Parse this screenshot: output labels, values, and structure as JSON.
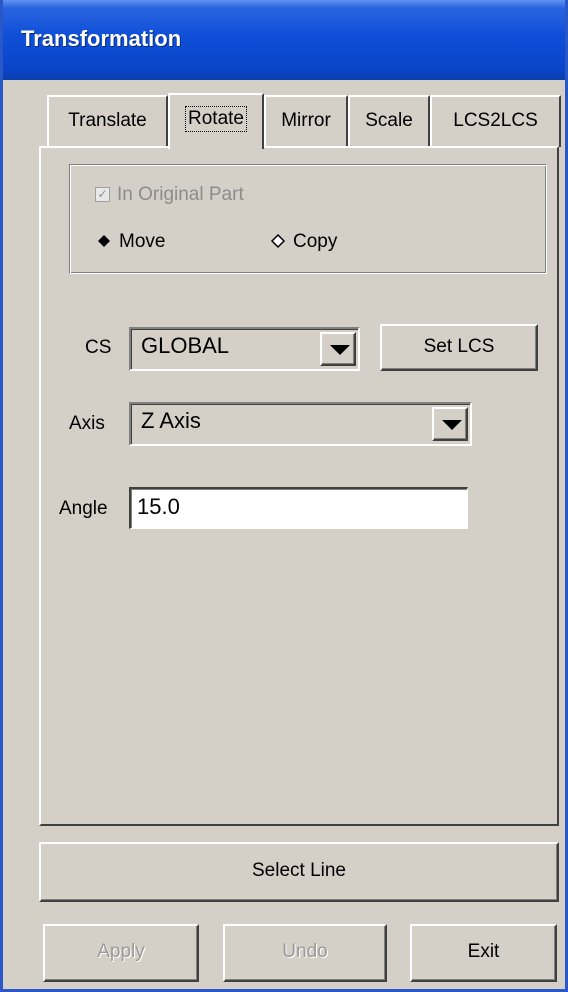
{
  "window": {
    "title": "Transformation"
  },
  "tabs": [
    {
      "label": "Translate",
      "active": false
    },
    {
      "label": "Rotate",
      "active": true
    },
    {
      "label": "Mirror",
      "active": false
    },
    {
      "label": "Scale",
      "active": false
    },
    {
      "label": "LCS2LCS",
      "active": false
    }
  ],
  "options": {
    "in_original_part_label": "In Original Part",
    "in_original_part_checked": true,
    "in_original_part_enabled": false,
    "move_label": "Move",
    "copy_label": "Copy",
    "selected_mode": "Move"
  },
  "cs": {
    "label": "CS",
    "value": "GLOBAL",
    "set_lcs_label": "Set LCS"
  },
  "axis": {
    "label": "Axis",
    "value": "Z Axis"
  },
  "angle": {
    "label": "Angle",
    "value": "15.0"
  },
  "select_line_label": "Select Line",
  "footer": {
    "apply_label": "Apply",
    "apply_enabled": false,
    "undo_label": "Undo",
    "undo_enabled": false,
    "exit_label": "Exit"
  },
  "colors": {
    "titlebar": "#0a45c9",
    "face": "#d4d0c8",
    "disabled_text": "#8c8c8c"
  },
  "icons": {
    "checkbox_mark": "check-icon",
    "radio_selected": "diamond-filled-icon",
    "radio_unselected": "diamond-outline-icon",
    "dropdown": "triangle-down-icon"
  }
}
